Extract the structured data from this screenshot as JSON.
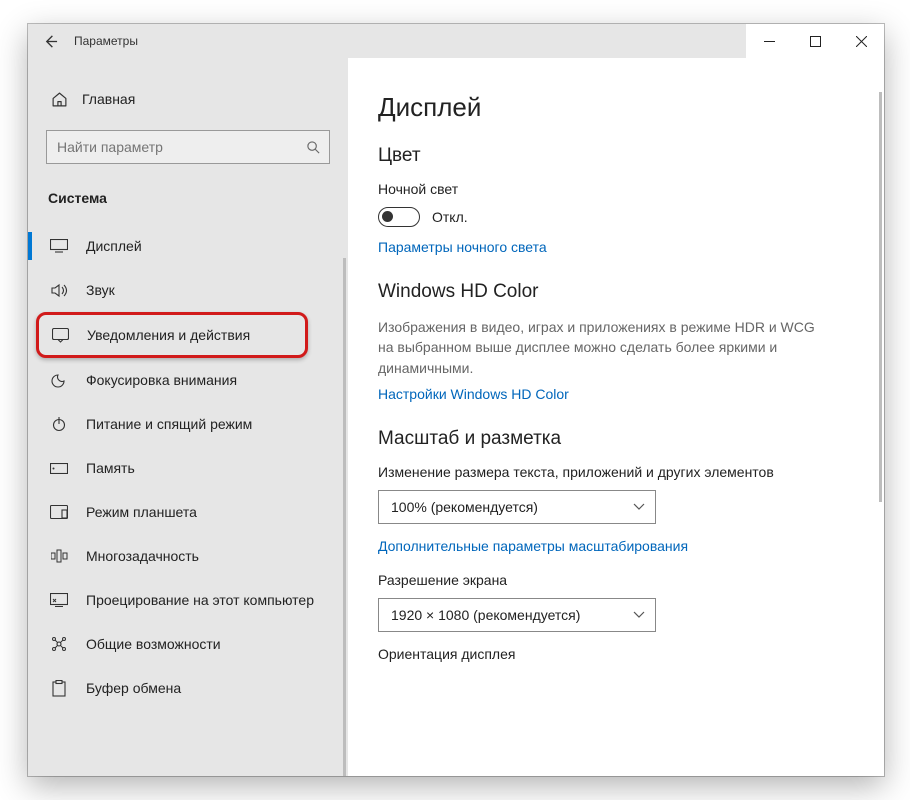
{
  "window_title": "Параметры",
  "sidebar": {
    "home": "Главная",
    "search_placeholder": "Найти параметр",
    "section": "Система",
    "items": [
      {
        "label": "Дисплей"
      },
      {
        "label": "Звук"
      },
      {
        "label": "Уведомления и действия"
      },
      {
        "label": "Фокусировка внимания"
      },
      {
        "label": "Питание и спящий режим"
      },
      {
        "label": "Память"
      },
      {
        "label": "Режим планшета"
      },
      {
        "label": "Многозадачность"
      },
      {
        "label": "Проецирование на этот компьютер"
      },
      {
        "label": "Общие возможности"
      },
      {
        "label": "Буфер обмена"
      }
    ]
  },
  "main": {
    "title": "Дисплей",
    "color": {
      "heading": "Цвет",
      "nightlight_label": "Ночной свет",
      "nightlight_state": "Откл.",
      "nightlight_link": "Параметры ночного света"
    },
    "hdcolor": {
      "heading": "Windows HD Color",
      "desc": "Изображения в видео, играх и приложениях в режиме HDR и WCG на выбранном выше дисплее можно сделать более яркими и динамичными.",
      "link": "Настройки Windows HD Color"
    },
    "scale": {
      "heading": "Масштаб и разметка",
      "size_label": "Изменение размера текста, приложений и других элементов",
      "size_value": "100% (рекомендуется)",
      "advanced_link": "Дополнительные параметры масштабирования",
      "resolution_label": "Разрешение экрана",
      "resolution_value": "1920 × 1080 (рекомендуется)",
      "orientation_label": "Ориентация дисплея"
    }
  }
}
